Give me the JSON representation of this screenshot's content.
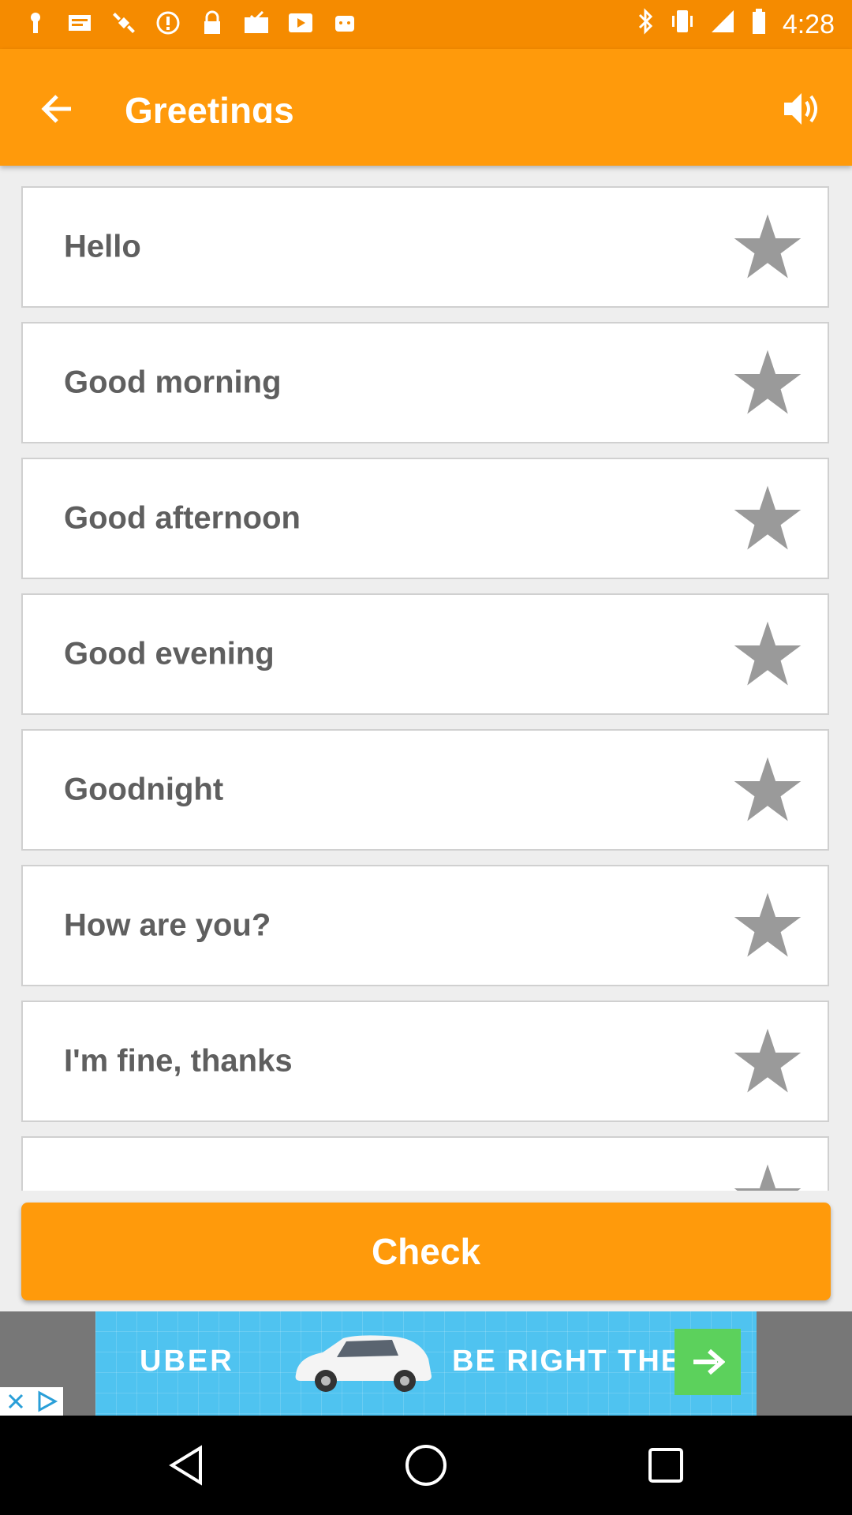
{
  "status_bar": {
    "time": "4:28",
    "icons": [
      "notification-icon",
      "message-icon",
      "satellite-icon",
      "alert-icon",
      "lock-icon",
      "mail-check-icon",
      "play-icon",
      "robot-icon"
    ],
    "right_icons": [
      "bluetooth-icon",
      "vibrate-icon",
      "signal-icon",
      "battery-icon"
    ]
  },
  "app_bar": {
    "title": "Greetings",
    "back_icon": "arrow-back-icon",
    "volume_icon": "volume-icon"
  },
  "phrases": [
    {
      "label": "Hello",
      "favorited": false
    },
    {
      "label": "Good morning",
      "favorited": false
    },
    {
      "label": "Good afternoon",
      "favorited": false
    },
    {
      "label": "Good evening",
      "favorited": false
    },
    {
      "label": "Goodnight",
      "favorited": false
    },
    {
      "label": "How are you?",
      "favorited": false
    },
    {
      "label": "I'm fine, thanks",
      "favorited": false
    },
    {
      "label": "",
      "favorited": false
    }
  ],
  "check_button": {
    "label": "Check"
  },
  "ad": {
    "brand": "UBER",
    "tagline": "BE RIGHT THERE",
    "colors": {
      "banner": "#4fc3f0",
      "arrow": "#5cd15c"
    }
  },
  "colors": {
    "accent": "#ff9a0b",
    "status_bar": "#f58b00",
    "star": "#9a9a9a",
    "card_text": "#5f5f5f"
  }
}
